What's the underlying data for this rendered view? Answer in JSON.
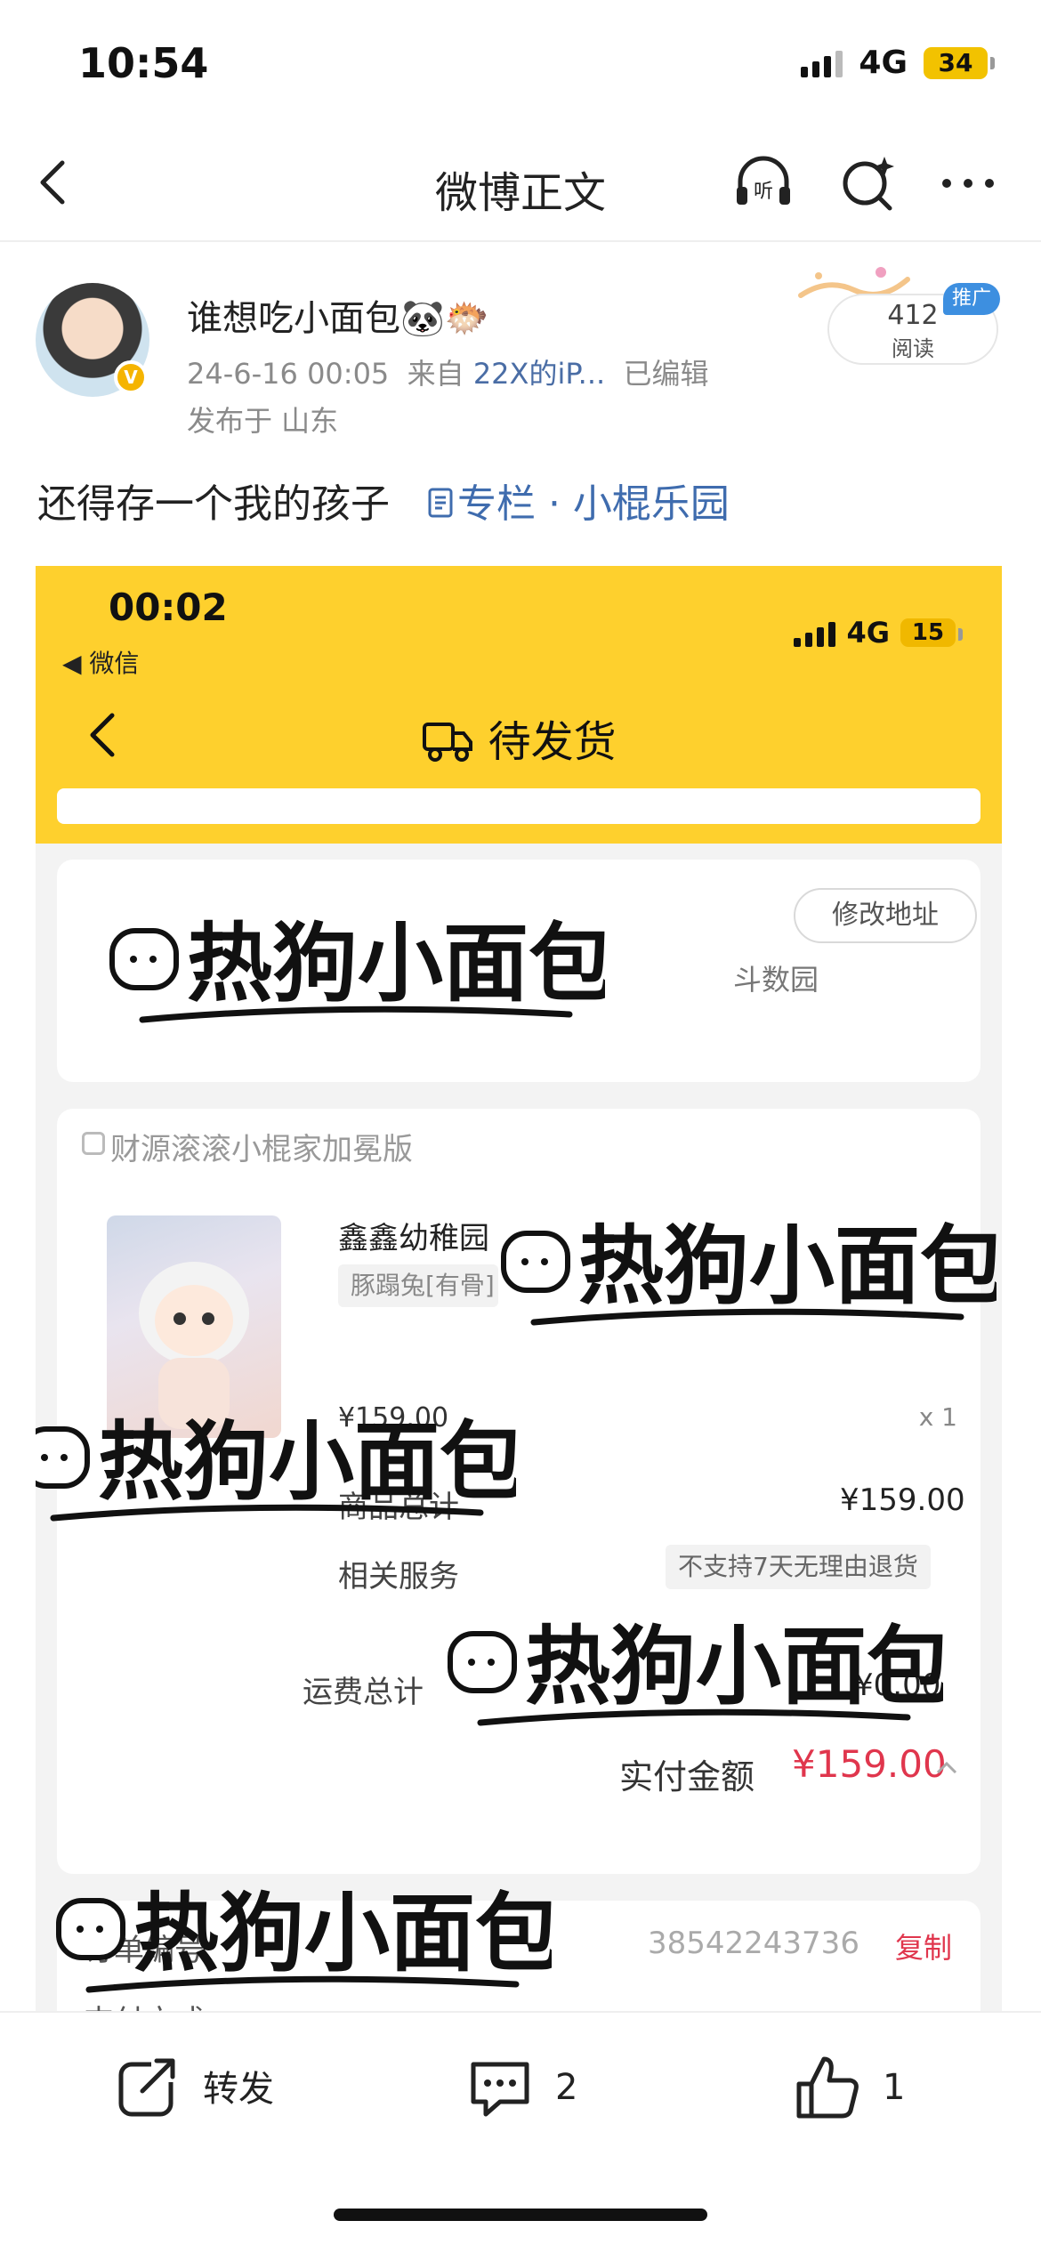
{
  "status_bar": {
    "time": "10:54",
    "network": "4G",
    "battery": "34"
  },
  "nav": {
    "title": "微博正文"
  },
  "post": {
    "author": "谁想吃小面包",
    "author_emoji": "🐼🐡",
    "date": "24-6-16 00:05",
    "source_prefix": "来自",
    "source_device": "22X的iP...",
    "edited": "已编辑",
    "location": "发布于 山东",
    "read_count": "412",
    "read_label": "阅读",
    "promo_badge": "推广",
    "text": "还得存一个我的孩子",
    "column_link": "专栏 · 小棍乐园"
  },
  "screenshot": {
    "time": "00:02",
    "back_app": "◀ 微信",
    "network": "4G",
    "battery": "15",
    "title": "待发货",
    "address_button": "修改地址",
    "address_fragment": "斗数园 ",
    "shop_name": "财源滚滚小棍家加冕版",
    "product_name": "鑫鑫幼稚园",
    "product_spec": "豚蹋兔[有骨]",
    "unit_price": "¥159.00",
    "quantity": "x 1",
    "goods_total_label": "商品总计",
    "goods_total": "¥159.00",
    "service_label": "相关服务",
    "service_value": "不支持7天无理由退货",
    "shipping_label": "运费总计",
    "shipping_value": "¥0.00",
    "paid_label": "实付金额",
    "paid_value": "¥159.00",
    "order_label": "订单编号",
    "order_number": "38542243736",
    "copy": "复制",
    "pay_method_label": "支付方式",
    "watermark": "热狗小面包"
  },
  "bottom_bar": {
    "repost": "转发",
    "comments": "2",
    "likes": "1"
  }
}
